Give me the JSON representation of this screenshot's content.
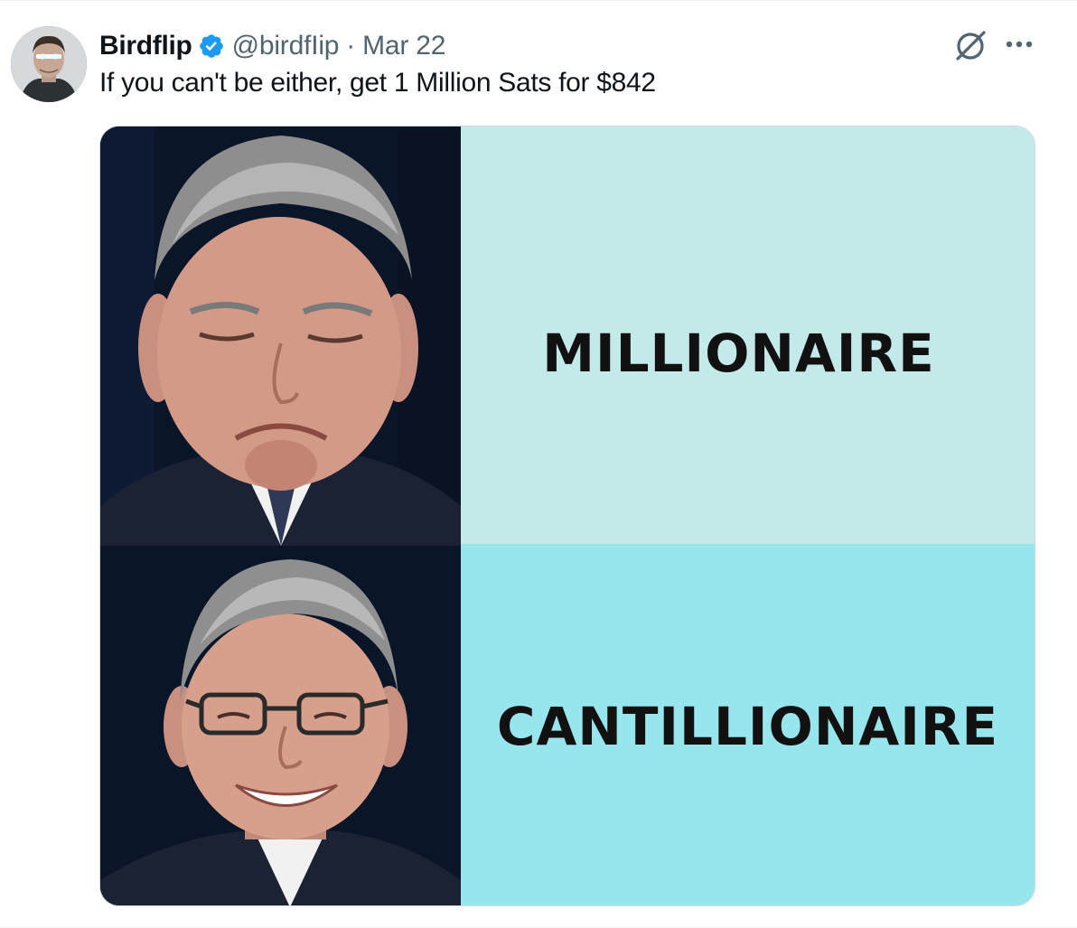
{
  "tweet": {
    "author": {
      "display_name": "Birdflip",
      "handle": "@birdfIip",
      "verified": true,
      "avatar_icon": "profile-avatar"
    },
    "separator": "·",
    "date": "Mar 22",
    "text": "If you can't be either, get 1 Million Sats for $842",
    "actions": {
      "grok_icon": "grok-icon",
      "more_icon": "more-icon"
    }
  },
  "meme": {
    "top_label": "MILLIONAIRE",
    "bottom_label": "CANTILLIONAIRE",
    "colors": {
      "top_panel": "#c3e9e9",
      "bottom_panel": "#98e6ed",
      "text": "#111111"
    }
  },
  "colors": {
    "primary_text": "#0f1419",
    "secondary_text": "#536471",
    "verified_badge": "#1d9bf0",
    "border": "#cfd9de"
  }
}
